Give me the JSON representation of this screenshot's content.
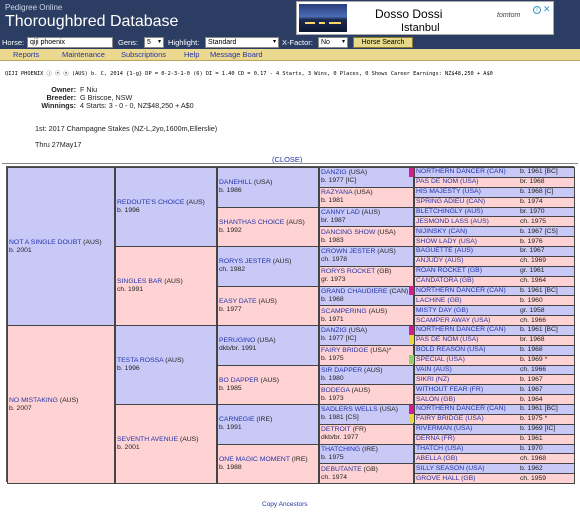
{
  "header": {
    "subtitle": "Pedigree Online",
    "title": "Thoroughbred Database"
  },
  "ad": {
    "title": "Dosso Dossi",
    "subtitle": "Istanbul",
    "logo": "tomtom"
  },
  "search": {
    "horse_label": "Horse:",
    "horse_value": "qiji phoenix",
    "gens_label": "Gens:",
    "gens_value": "5",
    "highlight_label": "Highlight:",
    "highlight_value": "Standard",
    "xfactor_label": "X-Factor:",
    "xfactor_value": "No",
    "button": "Horse Search"
  },
  "menu": [
    "Reports",
    "Maintenance",
    "Subscriptions",
    "Help",
    "Message Board"
  ],
  "horse": {
    "infoline": "QIJI PHOENIX  ⓘ ⓔ ⓝ  (AUS) b. C, 2014 {1-g} DP = 0-2-3-1-0 (6) DI = 1.40  CD = 0.17 - 4 Starts, 3 Wins, 0 Places, 0 Shows Career Earnings: NZ$48,250 + A$0",
    "details": [
      {
        "k": "Owner:",
        "v": "F Niu"
      },
      {
        "k": "Breeder:",
        "v": "G Briscoe, NSW"
      },
      {
        "k": "Winnings:",
        "v": "4 Starts: 3 - 0 - 0, NZ$48,250 + A$0"
      }
    ],
    "race": "1st: 2017 Champagne Stakes (NZ-L,2yo,1600m,Ellerslie)",
    "thru": "Thru 27May17",
    "close": "(CLOSE)"
  },
  "pedigree": {
    "g1": [
      {
        "n": "NOT A SINGLE DOUBT",
        "c": "(AUS)",
        "b": "b. 2001"
      },
      {
        "n": "NO MISTAKING",
        "c": "(AUS)",
        "b": "b. 2007"
      }
    ],
    "g2": [
      {
        "n": "REDOUTE'S CHOICE",
        "c": "(AUS)",
        "b": "b. 1996"
      },
      {
        "n": "SINGLES BAR",
        "c": "(AUS)",
        "b": "ch. 1991"
      },
      {
        "n": "TESTA ROSSA",
        "c": "(AUS)",
        "b": "b. 1996"
      },
      {
        "n": "SEVENTH AVENUE",
        "c": "(AUS)",
        "b": "b. 2001"
      }
    ],
    "g3": [
      {
        "n": "DANEHILL",
        "c": "(USA)",
        "b": "b. 1986"
      },
      {
        "n": "SHANTHAS CHOICE",
        "c": "(AUS)",
        "b": "b. 1992"
      },
      {
        "n": "RORYS JESTER",
        "c": "(AUS)",
        "b": "ch. 1982"
      },
      {
        "n": "EASY DATE",
        "c": "(AUS)",
        "b": "b. 1977"
      },
      {
        "n": "PERUGINO",
        "c": "(USA)",
        "b": "dkb/br. 1991"
      },
      {
        "n": "BO DAPPER",
        "c": "(AUS)",
        "b": "b. 1985"
      },
      {
        "n": "CARNEGIE",
        "c": "(IRE)",
        "b": "b. 1991"
      },
      {
        "n": "ONE MAGIC MOMENT",
        "c": "(IRE)",
        "b": "b. 1988"
      }
    ],
    "g4": [
      {
        "n": "DANZIG",
        "c": "(USA)",
        "b": "b. 1977 [IC]"
      },
      {
        "n": "RAZYANA",
        "c": "(USA)",
        "b": "b. 1981"
      },
      {
        "n": "CANNY LAD",
        "c": "(AUS)",
        "b": "br. 1987"
      },
      {
        "n": "DANCING SHOW",
        "c": "(USA)",
        "b": "b. 1983"
      },
      {
        "n": "CROWN JESTER",
        "c": "(AUS)",
        "b": "ch. 1978"
      },
      {
        "n": "RORYS ROCKET",
        "c": "(GB)",
        "b": "gr. 1973"
      },
      {
        "n": "GRAND CHAUDIERE",
        "c": "(CAN)",
        "b": "b. 1968"
      },
      {
        "n": "SCAMPERING",
        "c": "(AUS)",
        "b": "b. 1971"
      },
      {
        "n": "DANZIG",
        "c": "(USA)",
        "b": "b. 1977 [IC]"
      },
      {
        "n": "FAIRY BRIDGE",
        "c": "(USA)*",
        "b": "b. 1975"
      },
      {
        "n": "SIR DAPPER",
        "c": "(AUS)",
        "b": "b. 1980"
      },
      {
        "n": "BODEGA",
        "c": "(AUS)",
        "b": "b. 1973"
      },
      {
        "n": "SADLERS WELLS",
        "c": "(USA)",
        "b": "b. 1981 [CS]"
      },
      {
        "n": "DETROIT",
        "c": "(FR)",
        "b": "dkb/br. 1977"
      },
      {
        "n": "THATCHING",
        "c": "(IRE)",
        "b": "b. 1975"
      },
      {
        "n": "DEBUTANTE",
        "c": "(GB)",
        "b": "ch. 1974"
      }
    ],
    "g5": [
      [
        "NORTHERN DANCER (CAN)",
        "b. 1961 [BC]"
      ],
      [
        "PAS DE NOM (USA)",
        "br. 1968"
      ],
      [
        "HIS MAJESTY (USA)",
        "b. 1968 [C]"
      ],
      [
        "SPRING ADIEU (CAN)",
        "b. 1974"
      ],
      [
        "BLETCHINGLY (AUS)",
        "br. 1970"
      ],
      [
        "JESMOND LASS (AUS)",
        "ch. 1975"
      ],
      [
        "NIJINSKY (CAN)",
        "b. 1967 [CS]"
      ],
      [
        "SHOW LADY (USA)",
        "b. 1976"
      ],
      [
        "BAGUETTE (AUS)",
        "br. 1967"
      ],
      [
        "ANJUDY (AUS)",
        "ch. 1969"
      ],
      [
        "ROAN ROCKET (GB)",
        "gr. 1961"
      ],
      [
        "CANDATORA (GB)",
        "ch. 1964"
      ],
      [
        "NORTHERN DANCER (CAN)",
        "b. 1961 [BC]"
      ],
      [
        "LACHINE (GB)",
        "b. 1960"
      ],
      [
        "MISTY DAY (GB)",
        "gr. 1958"
      ],
      [
        "SCAMPER AWAY (USA)",
        "ch. 1966"
      ],
      [
        "NORTHERN DANCER (CAN)",
        "b. 1961 [BC]"
      ],
      [
        "PAS DE NOM (USA)",
        "br. 1968"
      ],
      [
        "BOLD REASON (USA)",
        "b. 1968"
      ],
      [
        "SPECIAL (USA)",
        "b. 1969 *"
      ],
      [
        "VAIN (AUS)",
        "ch. 1966"
      ],
      [
        "SIKRI (NZ)",
        "b. 1967"
      ],
      [
        "WITHOUT FEAR (FR)",
        "b. 1967"
      ],
      [
        "SALON (GB)",
        "b. 1964"
      ],
      [
        "NORTHERN DANCER (CAN)",
        "b. 1961 [BC]"
      ],
      [
        "FAIRY BRIDGE (USA)",
        "b. 1975 *"
      ],
      [
        "RIVERMAN (USA)",
        "b. 1969 [IC]"
      ],
      [
        "DERNA (FR)",
        "b. 1961"
      ],
      [
        "THATCH (USA)",
        "b. 1970"
      ],
      [
        "ABELLA (GB)",
        "ch. 1968"
      ],
      [
        "SILLY SEASON (USA)",
        "b. 1962"
      ],
      [
        "GROVE HALL (GB)",
        "ch. 1959"
      ]
    ]
  },
  "footer": {
    "copy": "Copy Ancestors"
  }
}
